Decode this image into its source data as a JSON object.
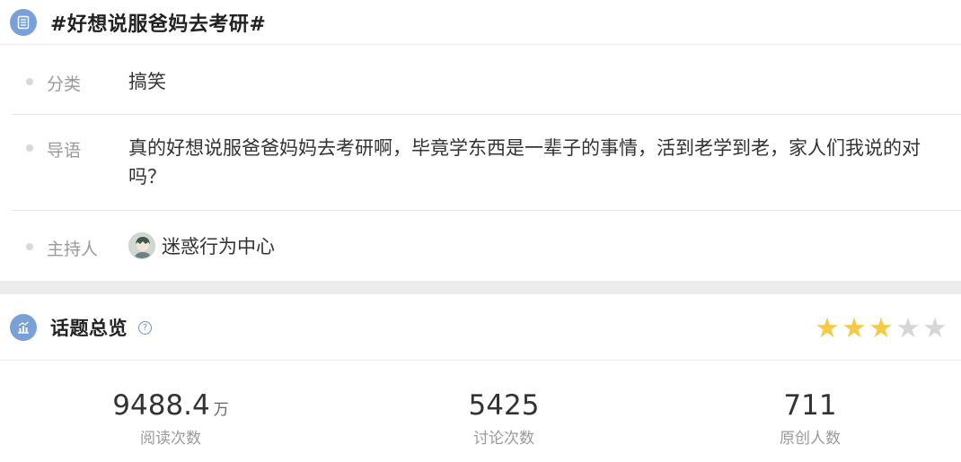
{
  "topic": {
    "title": "#好想说服爸妈去考研#",
    "icon": "list-icon"
  },
  "info": {
    "category": {
      "label": "分类",
      "value": "搞笑"
    },
    "intro": {
      "label": "导语",
      "value": "真的好想说服爸爸妈妈去考研啊，毕竟学东西是一辈子的事情，活到老学到老，家人们我说的对吗？"
    },
    "host": {
      "label": "主持人",
      "name": "迷惑行为中心",
      "avatar_icon": "avatar-icon"
    }
  },
  "overview": {
    "title": "话题总览",
    "icon": "chart-icon",
    "help_icon": "question-icon",
    "rating_stars": 3,
    "rating_max": 5,
    "star_on_color": "#f5ca46",
    "star_off_color": "#d6d6d6"
  },
  "stats": {
    "reads": {
      "value": "9488.4",
      "unit": "万",
      "label": "阅读次数"
    },
    "discussions": {
      "value": "5425",
      "label": "讨论次数"
    },
    "original_authors": {
      "value": "711",
      "label": "原创人数"
    }
  },
  "colors": {
    "accent": "#7aa0d8",
    "divider": "#ececec"
  }
}
